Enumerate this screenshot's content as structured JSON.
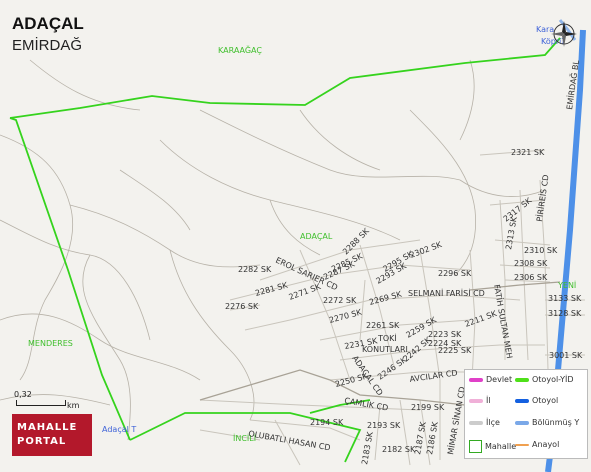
{
  "header": {
    "title": "ADAÇAL",
    "subtitle": "EMİRDAĞ"
  },
  "places": {
    "karaagac": "KARAAĞAÇ",
    "adacal": "ADAÇAL",
    "menderes": "MENDERES",
    "incili": "İNCİLİ",
    "yeni": "YENİ",
    "karagac_kopru": "Kara",
    "kopru": "Köprü",
    "adacal_t": "Adaçal T"
  },
  "streets": {
    "s2321": "2321 SK",
    "s2317": "2317 SK",
    "s2313": "2313 SK",
    "s2310": "2310 SK",
    "s2308": "2308 SK",
    "s2306": "2306 SK",
    "s3133": "3133 SK",
    "s3128": "3128 SK",
    "s3001": "3001 SK",
    "s2288": "2288 SK",
    "s2302": "2302 SK",
    "s2282": "2282 SK",
    "erol": "EROL SARIER CD",
    "s2285": "2285 SK",
    "s2287": "2287 SK",
    "s2295": "2295 SK",
    "s2293": "2293 SK",
    "s2296": "2296 SK",
    "s2281": "2281 SK",
    "s2271": "2271 SK",
    "s2272": "2272 SK",
    "s2276": "2276 SK",
    "s2269": "2269 SK",
    "selmani": "SELMANİ FARİSİ CD",
    "fatih": "FATİH SULTAN MEH",
    "s2270": "2270 SK",
    "s2261": "2261 SK",
    "s2231": "2231 SK",
    "toki": "TOKİ",
    "konutlari": "KONUTLARI",
    "s2259": "2259 SK",
    "s2223": "2223 SK",
    "s2224": "2224 SK",
    "s2225": "2225 SK",
    "s2211": "2211 SK",
    "adacal_cd": "ADAÇAL CD",
    "s2250": "2250 SK",
    "avcilar": "AVCILAR CD",
    "camlik": "ÇAMLIK CD",
    "s2199": "2199 SK",
    "s2194": "2194 SK",
    "s2193": "2193 SK",
    "s2187": "2187 SK",
    "s2186": "2186 SK",
    "s2182": "2182 SK",
    "s2183": "2183 SK",
    "olubatli": "OLUBATLI HASAN CD",
    "mimar": "MİMAR SİNAN CD",
    "emirdag_bl": "EMİRDAĞ BL",
    "pirireis": "PİRİREİS CD",
    "s2242": "2242 SK",
    "s2246": "2246 SK"
  },
  "scale": {
    "value": "0,32",
    "unit": "km"
  },
  "logo": {
    "line1": "MAHALLE",
    "line2": "PORTAL"
  },
  "legend": {
    "items": [
      {
        "label": "Devlet",
        "color": "#e040c8"
      },
      {
        "label": "Otoyol-YİD",
        "color": "#4fe01a"
      },
      {
        "label": "İl",
        "color": "#f0b0d8"
      },
      {
        "label": "Otoyol",
        "color": "#1460e0"
      },
      {
        "label": "İlçe",
        "color": "#cccccc"
      },
      {
        "label": "Bölünmüş Y",
        "color": "#7aa8e8"
      },
      {
        "label": "Mahalle",
        "color": "#33aa22"
      },
      {
        "label": "Anayol",
        "color": "#f0a050"
      }
    ]
  },
  "colors": {
    "boundary": "#35d31d",
    "highway": "#4d90e8",
    "road": "#aaa59c",
    "street": "#c8c4bb"
  }
}
